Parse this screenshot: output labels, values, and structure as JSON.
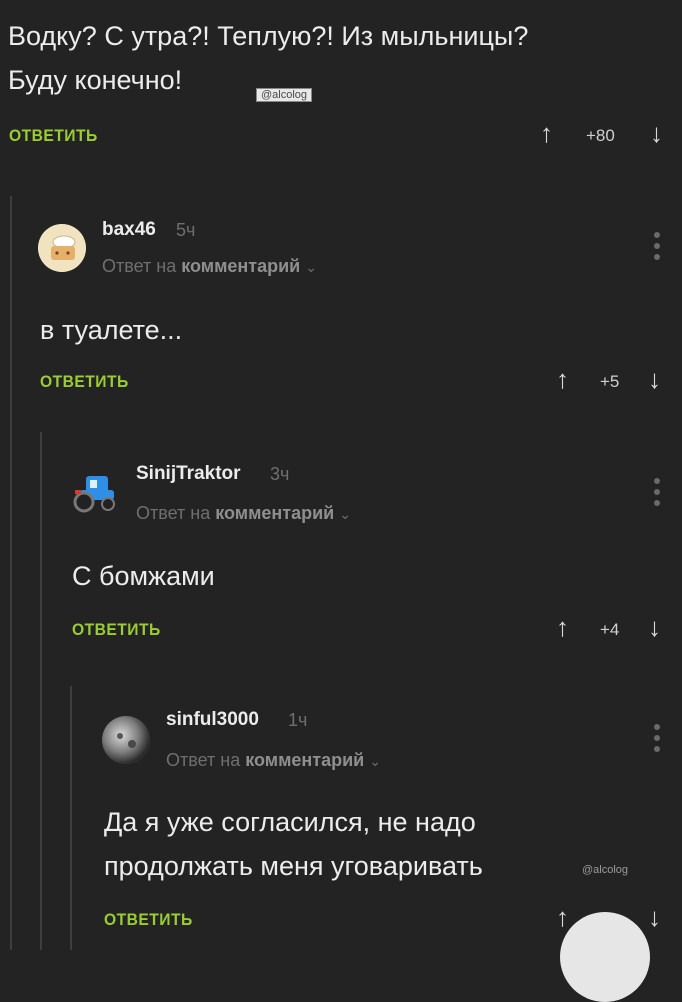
{
  "top_comment": {
    "text_line1": "Водку?  С утра?! Теплую?! Из мыльницы?",
    "text_line2": "Буду конечно!",
    "watermark": "@alcolog",
    "reply_label": "ОТВЕТИТЬ",
    "votes": "+80"
  },
  "comments": [
    {
      "author": "bax46",
      "time": "5ч",
      "reply_prefix": "Ответ на",
      "reply_target": "комментарий",
      "text": "в туалете...",
      "reply_label": "ОТВЕТИТЬ",
      "votes": "+5"
    },
    {
      "author": "SinijTraktor",
      "time": "3ч",
      "reply_prefix": "Ответ на",
      "reply_target": "комментарий",
      "text": "С бомжами",
      "reply_label": "ОТВЕТИТЬ",
      "votes": "+4"
    },
    {
      "author": "sinful3000",
      "time": "1ч",
      "reply_prefix": "Ответ на",
      "reply_target": "комментарий",
      "text_line1": "Да я уже согласился, не надо",
      "text_line2": "продолжать меня уговаривать",
      "watermark": "@alcolog",
      "reply_label": "ОТВЕТИТЬ"
    }
  ],
  "icons": {
    "upvote": "↑",
    "downvote": "↓",
    "chevron": "⌄"
  },
  "colors": {
    "background": "#232323",
    "reply_accent": "#9acd32"
  }
}
